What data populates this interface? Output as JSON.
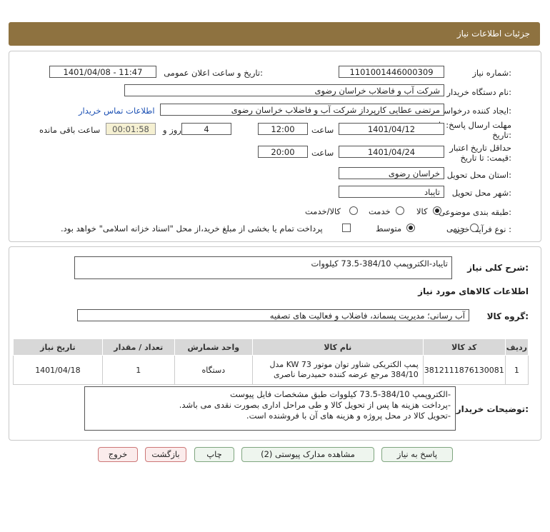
{
  "header": {
    "title": "جزئیات اطلاعات نیاز"
  },
  "form": {
    "need_number_label": "شماره نیاز:",
    "need_number": "1101001446000309",
    "announce_label": "تاریخ و ساعت اعلان عمومی:",
    "announce_value": "1401/04/08 - 11:47",
    "buyer_label": "نام دستگاه خریدار:",
    "buyer_value": "شرکت آب و فاضلاب خراسان رضوی",
    "creator_label": "ایجاد کننده درخواست:",
    "creator_value": "مرتضی عطایی کارپرداز شرکت آب و فاضلاب خراسان رضوی",
    "contact_link": "اطلاعات تماس خریدار",
    "deadline_label_1": "مهلت ارسال پاسخ: تا",
    "deadline_label_2": "تاریخ:",
    "deadline_date": "1401/04/12",
    "time_label": "ساعت",
    "deadline_time": "12:00",
    "days_value": "4",
    "days_label": "روز و",
    "remaining_value": "00:01:58",
    "remaining_label": "ساعت باقی مانده",
    "validity_label_1": "حداقل تاریخ اعتبار",
    "validity_label_2": "قیمت: تا تاریخ:",
    "validity_date": "1401/04/24",
    "validity_time_label": "ساعت",
    "validity_time": "20:00",
    "province_label": "استان محل تحویل:",
    "province_value": "خراسان رضوی",
    "city_label": "شهر محل تحویل:",
    "city_value": "تایباد",
    "category_label": "طبقه بندی موضوعی:",
    "category_options": [
      "کالا",
      "خدمت",
      "کالا/خدمت"
    ],
    "category_selected": 0,
    "process_label": "نوع فرآیند خرید :",
    "process_options": [
      "جزیی",
      "متوسط"
    ],
    "process_selected": 1,
    "payment_note": "پرداخت تمام یا بخشی از مبلغ خرید،از محل \"اسناد خزانه اسلامی\" خواهد بود."
  },
  "details": {
    "summary_label": "شرح کلی نیاز:",
    "summary_value": "تایباد-الکتروپمپ  384/10-73.5 کیلووات",
    "goods_info_title": "اطلاعات کالاهای مورد نیاز",
    "goods_group_label": "گروه کالا:",
    "goods_group_value": "آب رسانی؛ مدیریت پسماند، فاضلاب و فعالیت های تصفیه",
    "table": {
      "headers": [
        "ردیف",
        "کد کالا",
        "نام کالا",
        "واحد شمارش",
        "تعداد / مقدار",
        "تاریخ نیاز"
      ],
      "rows": [
        {
          "row": "1",
          "code": "3812111876130081",
          "name": "پمپ الکتریکی شناور توان موتور KW 73 مدل 384/10 مرجع عرضه کننده حمیدرضا ناصری",
          "unit": "دستگاه",
          "qty": "1",
          "date": "1401/04/18"
        }
      ]
    },
    "notes_label": "توضیحات خریدار:",
    "notes_lines": [
      "-الکتروپمپ 384/10-73.5 کیلووات طبق مشخصات فایل پیوست",
      "-پرداخت هزینه ها پس از تحویل کالا و طی مراحل اداری بصورت نقدی می باشد.",
      "-تحویل کالا در محل پروژه و هزینه های آن با فروشنده است."
    ]
  },
  "buttons": {
    "reply": "پاسخ به نیاز",
    "attachments": "مشاهده مدارک پیوستی (2)",
    "print": "چاپ",
    "back": "بازگشت",
    "exit": "خروج"
  },
  "watermark": {
    "brand": "ParsNamadData",
    "tagline": "پایگاه اطلاع رسانی مناقصه"
  }
}
